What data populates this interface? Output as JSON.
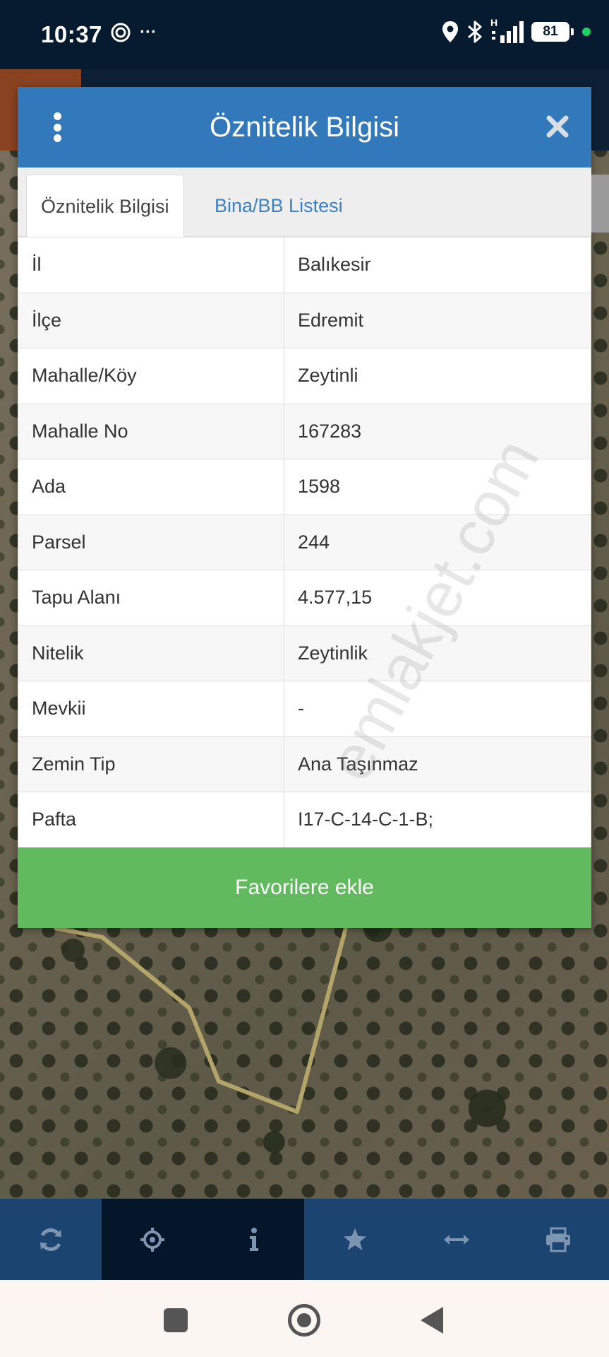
{
  "status_bar": {
    "time": "10:37",
    "ellipsis": "···",
    "network_badge": "H",
    "battery": "81",
    "icons": [
      "at-icon",
      "location-icon",
      "bluetooth-icon",
      "signal-icon",
      "battery-icon",
      "green-dot-icon"
    ]
  },
  "popup": {
    "title": "Öznitelik Bilgisi",
    "tabs": [
      {
        "label": "Öznitelik Bilgisi",
        "active": true
      },
      {
        "label": "Bina/BB Listesi",
        "active": false
      }
    ],
    "rows": [
      {
        "key": "İl",
        "value": "Balıkesir"
      },
      {
        "key": "İlçe",
        "value": "Edremit"
      },
      {
        "key": "Mahalle/Köy",
        "value": "Zeytinli"
      },
      {
        "key": "Mahalle No",
        "value": "167283"
      },
      {
        "key": "Ada",
        "value": "1598"
      },
      {
        "key": "Parsel",
        "value": "244"
      },
      {
        "key": "Tapu Alanı",
        "value": "4.577,15"
      },
      {
        "key": "Nitelik",
        "value": "Zeytinlik"
      },
      {
        "key": "Mevkii",
        "value": "-"
      },
      {
        "key": "Zemin Tip",
        "value": "Ana Taşınmaz"
      },
      {
        "key": "Pafta",
        "value": "I17-C-14-C-1-B;"
      }
    ],
    "favorite_button": "Favorilere ekle",
    "header_color": "#3179bb",
    "button_color": "#62ba5e"
  },
  "watermark": "emlakjet.com",
  "toolbar": {
    "tools": [
      "refresh-icon",
      "crosshair-icon",
      "info-icon",
      "star-icon",
      "measure-icon",
      "print-icon"
    ]
  },
  "nav_bar": {
    "buttons": [
      "recents-button",
      "home-button",
      "back-button"
    ]
  }
}
